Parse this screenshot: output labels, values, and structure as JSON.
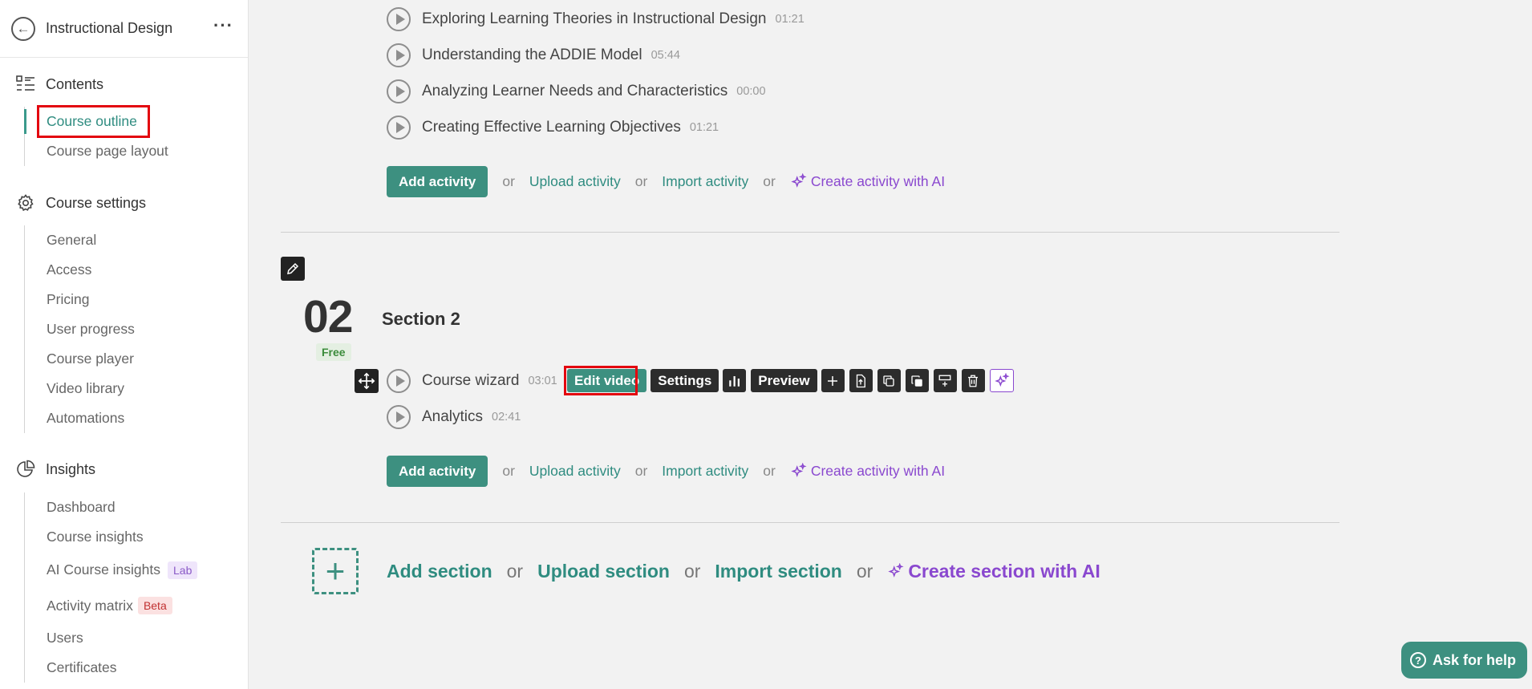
{
  "sidebar": {
    "title": "Instructional Design",
    "more_icon": "more-horizontal-icon",
    "contents": {
      "label": "Contents",
      "items": [
        {
          "label": "Course outline"
        },
        {
          "label": "Course page layout"
        }
      ]
    },
    "settings": {
      "label": "Course settings",
      "items": [
        {
          "label": "General"
        },
        {
          "label": "Access"
        },
        {
          "label": "Pricing"
        },
        {
          "label": "User progress"
        },
        {
          "label": "Course player"
        },
        {
          "label": "Video library"
        },
        {
          "label": "Automations"
        }
      ]
    },
    "insights": {
      "label": "Insights",
      "items": [
        {
          "label": "Dashboard"
        },
        {
          "label": "Course insights"
        },
        {
          "label": "AI Course insights",
          "tag": "Lab"
        },
        {
          "label": "Activity matrix",
          "tag": "Beta"
        },
        {
          "label": "Users"
        },
        {
          "label": "Certificates"
        }
      ]
    }
  },
  "section1": {
    "activities": [
      {
        "title": "Exploring Learning Theories in Instructional Design",
        "duration": "01:21"
      },
      {
        "title": "Understanding the ADDIE Model",
        "duration": "05:44"
      },
      {
        "title": "Analyzing Learner Needs and Characteristics",
        "duration": "00:00"
      },
      {
        "title": "Creating Effective Learning Objectives",
        "duration": "01:21"
      }
    ]
  },
  "add_activity": {
    "button": "Add activity",
    "or": "or",
    "upload": "Upload activity",
    "import": "Import activity",
    "ai": "Create activity with AI"
  },
  "section2": {
    "number": "02",
    "title": "Section 2",
    "badge": "Free",
    "activities": [
      {
        "title": "Course wizard",
        "duration": "03:01"
      },
      {
        "title": "Analytics",
        "duration": "02:41"
      }
    ],
    "toolbar": {
      "edit_video": "Edit video",
      "settings": "Settings",
      "preview": "Preview"
    }
  },
  "add_section": {
    "add": "Add section",
    "or": "or",
    "upload": "Upload section",
    "import": "Import section",
    "ai": "Create section with AI"
  },
  "help": {
    "label": "Ask for help"
  },
  "colors": {
    "accent": "#3d9080",
    "ai": "#8a48cf",
    "highlight": "#e3060f"
  }
}
